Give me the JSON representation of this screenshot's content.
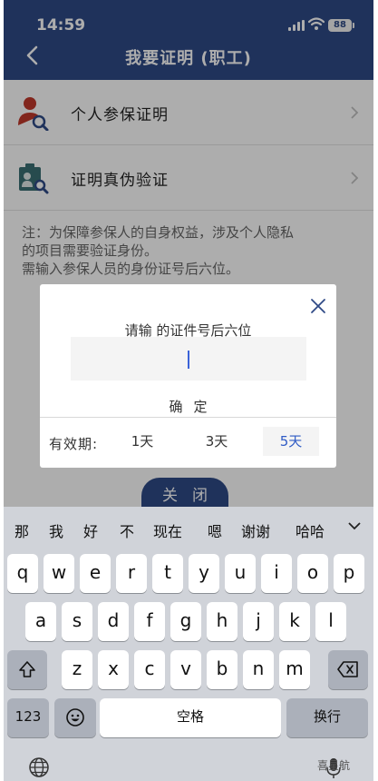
{
  "status_bar": {
    "time": "14:59",
    "battery": "88"
  },
  "header": {
    "title": "我要证明 (职工)"
  },
  "menu": [
    {
      "label": "个人参保证明"
    },
    {
      "label": "证明真伪验证"
    }
  ],
  "note": {
    "line1": "注：为保障参保人的自身权益，涉及个人隐私",
    "line2": "的项目需要验证身份。",
    "line3": "需输入参保人员的身份证号后六位。"
  },
  "close_button": "关闭",
  "dialog": {
    "prompt": "请输      的证件号后六位",
    "input_value": "",
    "confirm_label": "确定",
    "validity_label": "有效期:",
    "options": [
      "1天",
      "3天",
      "5天"
    ],
    "selected_option": "5天"
  },
  "keyboard": {
    "candidates": [
      "那",
      "我",
      "好",
      "不",
      "现在",
      "嗯",
      "谢谢",
      "哈哈"
    ],
    "row1": [
      "q",
      "w",
      "e",
      "r",
      "t",
      "y",
      "u",
      "i",
      "o",
      "p"
    ],
    "row2": [
      "a",
      "s",
      "d",
      "f",
      "g",
      "h",
      "j",
      "k",
      "l"
    ],
    "row3": [
      "z",
      "x",
      "c",
      "v",
      "b",
      "n",
      "m"
    ],
    "num_label": "123",
    "space_label": "空格",
    "return_label": "换行"
  },
  "watermark": "喜星航",
  "colors": {
    "header": "#2f4a86",
    "accent": "#2f5bc5"
  },
  "icons": [
    "back-arrow-icon",
    "person-search-icon",
    "certificate-search-icon",
    "chevron-right-icon",
    "close-icon",
    "shift-icon",
    "delete-icon",
    "emoji-icon",
    "globe-icon",
    "microphone-icon"
  ]
}
